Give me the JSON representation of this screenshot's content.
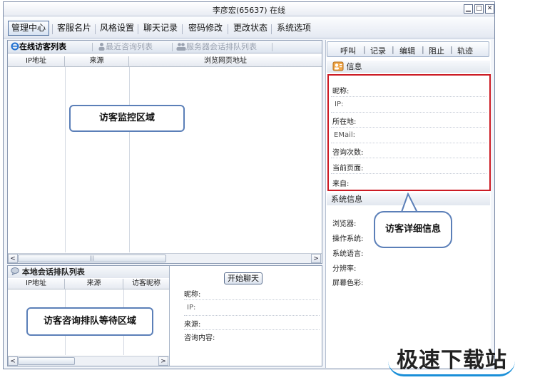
{
  "window": {
    "title": "李彦宏(65637) 在线",
    "min_glyph": "▁",
    "max_glyph": "□",
    "close_glyph": "✕"
  },
  "menu": {
    "items": [
      "管理中心",
      "客服名片",
      "风格设置",
      "聊天记录",
      "密码修改",
      "更改状态",
      "系统选项"
    ]
  },
  "visitors": {
    "tabs": [
      "在线访客列表",
      "最近咨询列表",
      "服务器会话排队列表"
    ],
    "columns": [
      "IP地址",
      "来源",
      "浏览网页地址"
    ],
    "callout": "访客监控区域"
  },
  "queue": {
    "title": "本地会话排队列表",
    "columns": [
      "IP地址",
      "来源",
      "访客昵称"
    ],
    "callout": "访客咨询排队等待区域",
    "start_button": "开始聊天",
    "fields": [
      "昵称:",
      "IP:",
      "来源:",
      "咨询内容:"
    ]
  },
  "scroll": {
    "left": "<",
    "right": ">",
    "grip": "|||"
  },
  "right": {
    "actions": [
      "呼叫",
      "记录",
      "编辑",
      "阻止",
      "轨迹"
    ],
    "action_sep": "|",
    "info_title": "信息",
    "info_fields": [
      "昵称:",
      "IP:",
      "所在地:",
      "EMail:",
      "咨询次数:",
      "当前页面:",
      "来自:"
    ],
    "sys_title": "系统信息",
    "sys_fields": [
      "浏览器:",
      "操作系统:",
      "系统语言:",
      "分辨率:",
      "屏幕色彩:"
    ],
    "callout": "访客详细信息"
  },
  "watermark": "极速下载站",
  "colors": {
    "highlight_border": "#cc1b24",
    "callout_border": "#5b7fb8",
    "watermark_accent": "#1a8fd8"
  }
}
